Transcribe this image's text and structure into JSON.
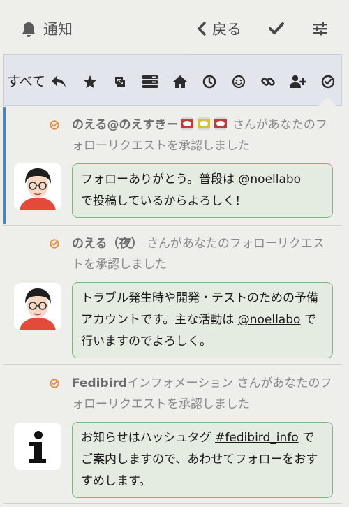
{
  "header": {
    "title": "通知",
    "back_label": "戻る",
    "icons": [
      "bell-icon",
      "chevron-left-icon",
      "check-icon",
      "sliders-icon"
    ]
  },
  "filter_bar": {
    "all_label": "すべて",
    "icons": [
      "reply-icon",
      "star-icon",
      "boost-icon",
      "list-icon",
      "home-icon",
      "clock-icon",
      "smile-icon",
      "link-icon",
      "user-plus-icon",
      "check-circle-icon"
    ],
    "accent": "#3a8ad6"
  },
  "notifications": [
    {
      "actor": "のえる@のえすきー",
      "actor_emoji": [
        "can-emoji-red",
        "can-emoji-yellow",
        "can-emoji-red"
      ],
      "action": " さんがあなたのフォローリクエストを承認しました",
      "bubble_pre": "フォローありがとう。普段は ",
      "bubble_link": "@noellabo",
      "bubble_post": "で投稿しているからよろしく！"
    },
    {
      "actor": "のえる（夜）",
      "action": " さんがあなたのフォローリクエストを承認しました",
      "bubble_pre": "トラブル発生時や開発・テストのための予備アカウントです。主な活動は ",
      "bubble_link": "@noellabo",
      "bubble_post": " で行いますのでよろしく。"
    },
    {
      "actor": "Fedibird",
      "actor_suffix": "インフォメーション",
      "action": " さんがあなたのフォローリクエストを承認しました",
      "bubble_pre": "お知らせはハッシュタグ ",
      "bubble_link": "#fedibird_info",
      "bubble_post": " でご案内しますので、あわせてフォローをおすすめします。"
    }
  ],
  "colors": {
    "status_icon": "#e08a3a",
    "bubble_bg": "#e4ece2",
    "bubble_border": "#7fb585"
  }
}
